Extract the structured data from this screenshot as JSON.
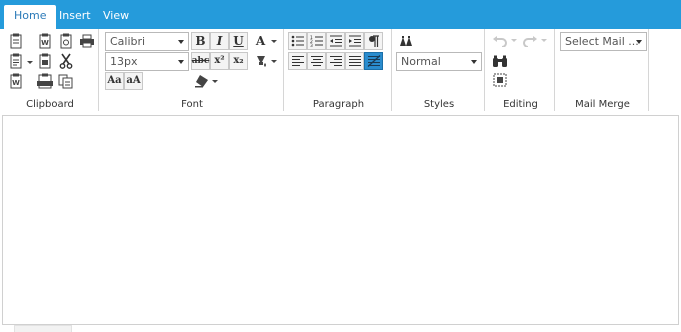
{
  "tabs": [
    {
      "label": "Home",
      "active": true
    },
    {
      "label": "Insert",
      "active": false
    },
    {
      "label": "View",
      "active": false
    }
  ],
  "groups": {
    "clipboard": "Clipboard",
    "font": "Font",
    "paragraph": "Paragraph",
    "styles": "Styles",
    "editing": "Editing",
    "mail_merge": "Mail Merge"
  },
  "font": {
    "family_value": "Calibri",
    "size_value": "13px",
    "bold_label": "B",
    "italic_label": "I",
    "underline_label": "U",
    "strike_label": "abc",
    "superscript_label": "x²",
    "subscript_label": "x₂",
    "shrink_label": "Aa",
    "grow_label": "aA",
    "color_label": "A"
  },
  "styles": {
    "value": "Normal"
  },
  "mail_merge": {
    "value": "Select Mail ..."
  },
  "paragraph": {
    "rtl_pressed": true
  },
  "colors": {
    "tabbar": "#259bdb",
    "accent": "#2a8cce",
    "border": "#d6d6d6"
  },
  "editor": {
    "content": ""
  }
}
